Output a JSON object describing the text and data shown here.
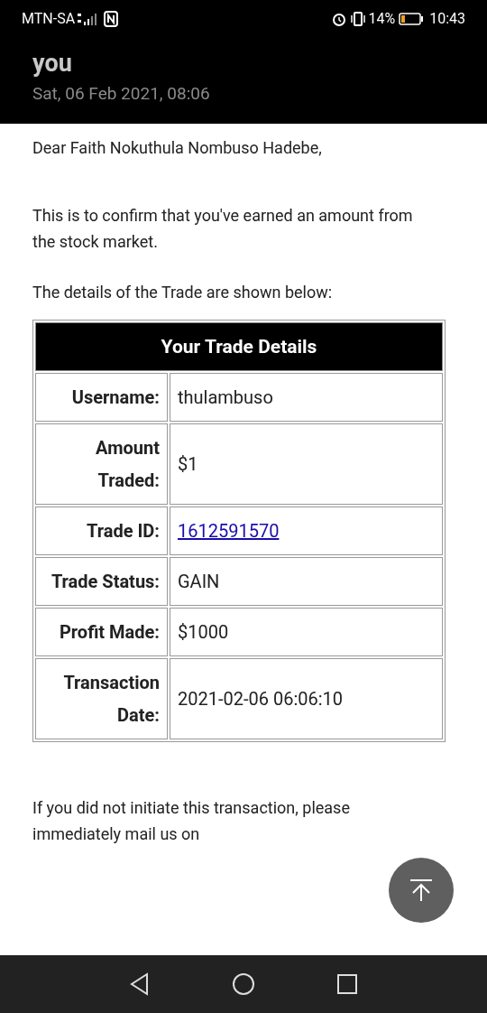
{
  "status_bar": {
    "carrier": "MTN-SA",
    "battery": "14%",
    "time": "10:43"
  },
  "header": {
    "title": "you",
    "date": "Sat, 06 Feb 2021, 08:06"
  },
  "body": {
    "greeting": "Dear Faith Nokuthula Nombuso Hadebe,",
    "intro": "This is to confirm that you've earned an amount from the stock market.",
    "lead": "The details of the Trade are shown below:"
  },
  "table": {
    "title": "Your Trade Details",
    "rows": [
      {
        "label": "Username:",
        "value": "thulambuso",
        "kind": "text"
      },
      {
        "label": "Amount Traded:",
        "value": "$1",
        "kind": "text"
      },
      {
        "label": "Trade ID:",
        "value": "1612591570",
        "kind": "link"
      },
      {
        "label": "Trade Status:",
        "value": "GAIN",
        "kind": "text"
      },
      {
        "label": "Profit Made:",
        "value": "$1000",
        "kind": "text"
      },
      {
        "label": "Transaction Date:",
        "value": "2021-02-06 06:06:10",
        "kind": "text"
      }
    ]
  },
  "footer_text": "If you did not initiate this transaction, please immediately mail us on"
}
